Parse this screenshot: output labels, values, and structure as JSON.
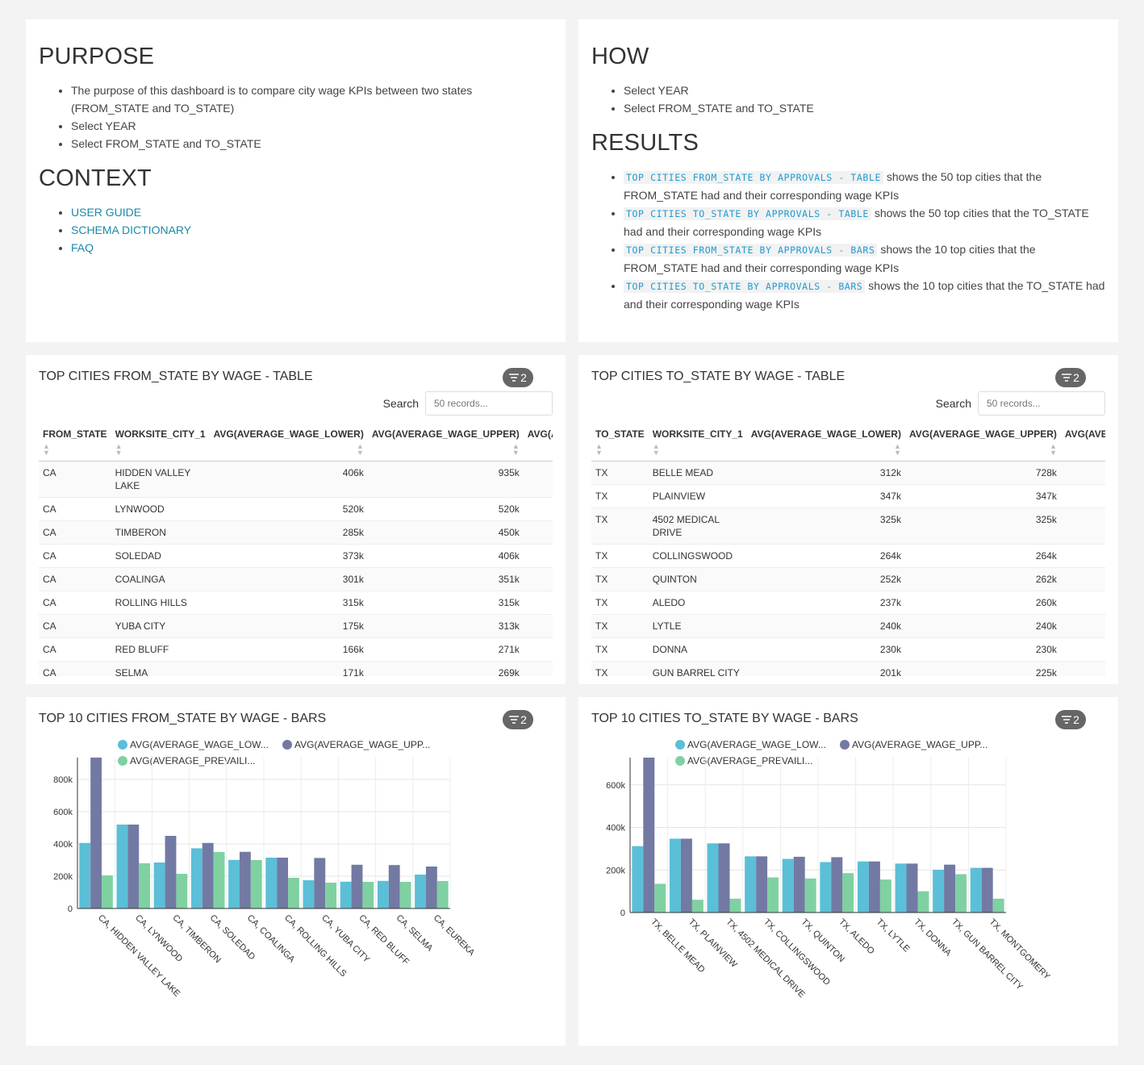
{
  "purpose": {
    "title": "PURPOSE",
    "items": [
      "The purpose of this dashboard is to compare city wage KPIs between two states (FROM_STATE and TO_STATE)",
      "Select YEAR",
      "Select FROM_STATE and TO_STATE"
    ],
    "context_title": "CONTEXT",
    "links": [
      "USER GUIDE",
      "SCHEMA DICTIONARY",
      "FAQ"
    ]
  },
  "how": {
    "title": "HOW",
    "items": [
      "Select YEAR",
      "Select FROM_STATE and TO_STATE"
    ],
    "results_title": "RESULTS",
    "results": [
      {
        "code": "TOP CITIES FROM_STATE BY APPROVALS - TABLE",
        "text": " shows the 50 top cities that the FROM_STATE had and their corresponding wage KPIs"
      },
      {
        "code": "TOP CITIES TO_STATE BY APPROVALS - TABLE",
        "text": " shows the 50 top cities that the TO_STATE had and their corresponding wage KPIs"
      },
      {
        "code": "TOP CITIES FROM_STATE BY APPROVALS - BARS",
        "text": " shows the 10 top cities that the FROM_STATE had and their corresponding wage KPIs"
      },
      {
        "code": "TOP CITIES TO_STATE BY APPROVALS - BARS",
        "text": " shows the 10 top cities that the TO_STATE had and their corresponding wage KPIs"
      }
    ]
  },
  "table_from": {
    "title": "TOP CITIES FROM_STATE BY WAGE - TABLE",
    "filter_count": "2",
    "search_label": "Search",
    "search_placeholder": "50 records...",
    "columns": [
      "FROM_STATE",
      "WORKSITE_CITY_1",
      "AVG(AVERAGE_WAGE_LOWER)",
      "AVG(AVERAGE_WAGE_UPPER)",
      "AVG(AVERAGE_PREVAILING_WAGE)"
    ],
    "rows": [
      [
        "CA",
        "HIDDEN VALLEY LAKE",
        "406k",
        "935k"
      ],
      [
        "CA",
        "LYNWOOD",
        "520k",
        "520k"
      ],
      [
        "CA",
        "TIMBERON",
        "285k",
        "450k"
      ],
      [
        "CA",
        "SOLEDAD",
        "373k",
        "406k"
      ],
      [
        "CA",
        "COALINGA",
        "301k",
        "351k"
      ],
      [
        "CA",
        "ROLLING HILLS",
        "315k",
        "315k"
      ],
      [
        "CA",
        "YUBA CITY",
        "175k",
        "313k"
      ],
      [
        "CA",
        "RED BLUFF",
        "166k",
        "271k"
      ],
      [
        "CA",
        "SELMA",
        "171k",
        "269k"
      ]
    ]
  },
  "table_to": {
    "title": "TOP CITIES TO_STATE BY WAGE - TABLE",
    "filter_count": "2",
    "search_label": "Search",
    "search_placeholder": "50 records...",
    "columns": [
      "TO_STATE",
      "WORKSITE_CITY_1",
      "AVG(AVERAGE_WAGE_LOWER)",
      "AVG(AVERAGE_WAGE_UPPER)",
      "AVG(AVERAGE_PREVAILING_WAGE)"
    ],
    "rows": [
      [
        "TX",
        "BELLE MEAD",
        "312k",
        "728k"
      ],
      [
        "TX",
        "PLAINVIEW",
        "347k",
        "347k"
      ],
      [
        "TX",
        "4502 MEDICAL DRIVE",
        "325k",
        "325k"
      ],
      [
        "TX",
        "COLLINGSWOOD",
        "264k",
        "264k"
      ],
      [
        "TX",
        "QUINTON",
        "252k",
        "262k"
      ],
      [
        "TX",
        "ALEDO",
        "237k",
        "260k"
      ],
      [
        "TX",
        "LYTLE",
        "240k",
        "240k"
      ],
      [
        "TX",
        "DONNA",
        "230k",
        "230k"
      ],
      [
        "TX",
        "GUN BARREL CITY",
        "201k",
        "225k"
      ]
    ]
  },
  "bars_from": {
    "title": "TOP 10 CITIES FROM_STATE BY WAGE - BARS",
    "filter_count": "2"
  },
  "bars_to": {
    "title": "TOP 10 CITIES TO_STATE BY WAGE - BARS",
    "filter_count": "2"
  },
  "legend_labels": [
    "AVG(AVERAGE_WAGE_LOW...",
    "AVG(AVERAGE_WAGE_UPP...",
    "AVG(AVERAGE_PREVAILI..."
  ],
  "colors": {
    "lower": "#5bbfd8",
    "upper": "#727aa3",
    "prevailing": "#7fd1a2"
  },
  "chart_data": [
    {
      "type": "bar",
      "title": "TOP 10 CITIES FROM_STATE BY WAGE - BARS",
      "categories": [
        "CA, HIDDEN VALLEY LAKE",
        "CA, LYNWOOD",
        "CA, TIMBERON",
        "CA, SOLEDAD",
        "CA, COALINGA",
        "CA, ROLLING HILLS",
        "CA, YUBA CITY",
        "CA, RED BLUFF",
        "CA, SELMA",
        "CA, EUREKA"
      ],
      "series": [
        {
          "name": "AVG(AVERAGE_WAGE_LOW...",
          "values": [
            406000,
            520000,
            285000,
            373000,
            301000,
            315000,
            175000,
            166000,
            171000,
            210000
          ]
        },
        {
          "name": "AVG(AVERAGE_WAGE_UPP...",
          "values": [
            935000,
            520000,
            450000,
            406000,
            351000,
            315000,
            313000,
            271000,
            269000,
            260000
          ]
        },
        {
          "name": "AVG(AVERAGE_PREVAILI...",
          "values": [
            205000,
            280000,
            215000,
            350000,
            300000,
            190000,
            160000,
            165000,
            165000,
            170000
          ]
        }
      ],
      "ylim": [
        0,
        935000
      ],
      "yticks": [
        0,
        200000,
        400000,
        600000,
        800000
      ],
      "ytick_labels": [
        "0",
        "200k",
        "400k",
        "600k",
        "800k"
      ]
    },
    {
      "type": "bar",
      "title": "TOP 10 CITIES TO_STATE BY WAGE - BARS",
      "categories": [
        "TX, BELLE MEAD",
        "TX, PLAINVIEW",
        "TX, 4502 MEDICAL DRIVE",
        "TX, COLLINGSWOOD",
        "TX, QUINTON",
        "TX, ALEDO",
        "TX, LYTLE",
        "TX, DONNA",
        "TX, GUN BARREL CITY",
        "TX, MONTGOMERY"
      ],
      "series": [
        {
          "name": "AVG(AVERAGE_WAGE_LOW...",
          "values": [
            312000,
            347000,
            325000,
            264000,
            252000,
            237000,
            240000,
            230000,
            201000,
            210000
          ]
        },
        {
          "name": "AVG(AVERAGE_WAGE_UPP...",
          "values": [
            728000,
            347000,
            325000,
            264000,
            262000,
            260000,
            240000,
            230000,
            225000,
            210000
          ]
        },
        {
          "name": "AVG(AVERAGE_PREVAILI...",
          "values": [
            135000,
            60000,
            65000,
            165000,
            160000,
            185000,
            155000,
            100000,
            180000,
            65000
          ]
        }
      ],
      "ylim": [
        0,
        728000
      ],
      "yticks": [
        0,
        200000,
        400000,
        600000
      ],
      "ytick_labels": [
        "0",
        "200k",
        "400k",
        "600k"
      ]
    }
  ]
}
